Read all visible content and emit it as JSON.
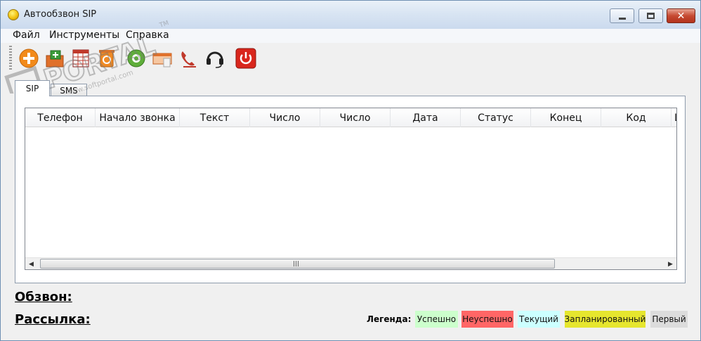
{
  "window": {
    "title": "Автообзвон SIP"
  },
  "menu": [
    "Файл",
    "Инструменты",
    "Справка"
  ],
  "toolbar": {
    "buttons": [
      {
        "name": "add-icon",
        "color": "#f28a1a"
      },
      {
        "name": "import-icon",
        "color": "#3b9b3b"
      },
      {
        "name": "table-icon",
        "color": "#c0392b"
      },
      {
        "name": "recycle-icon",
        "color": "#f08a24"
      },
      {
        "name": "settings-icon",
        "color": "#5fae3a"
      },
      {
        "name": "card-icon",
        "color": "#e0702a"
      },
      {
        "name": "phone-icon",
        "color": "#c0392b"
      },
      {
        "name": "headset-icon",
        "color": "#222222"
      },
      {
        "name": "power-icon",
        "color": "#d9261c"
      }
    ]
  },
  "tabs": [
    {
      "label": "SIP",
      "active": true
    },
    {
      "label": "SMS",
      "active": false
    }
  ],
  "grid": {
    "columns": [
      {
        "label": "Телефон"
      },
      {
        "label": "Начало звонка"
      },
      {
        "label": "Текст"
      },
      {
        "label": "Число"
      },
      {
        "label": "Число"
      },
      {
        "label": "Дата"
      },
      {
        "label": "Статус"
      },
      {
        "label": "Конец"
      },
      {
        "label": "Код"
      },
      {
        "label": "Ц"
      }
    ],
    "rows": [],
    "scroll_grip": "III"
  },
  "status": {
    "dial_label": "Обзвон:",
    "mailing_label": "Рассылка:"
  },
  "legend": {
    "title": "Легенда:",
    "items": [
      {
        "label": "Успешно",
        "color": "#ccffcc"
      },
      {
        "label": "Неуспешно",
        "color": "#ff6666"
      },
      {
        "label": "Текущий",
        "color": "#ccffff"
      },
      {
        "label": "Запланированный",
        "color": "#e6e62e"
      },
      {
        "label": "Первый",
        "color": "#dcdcdc"
      }
    ]
  },
  "watermark": {
    "text": "PORTAL",
    "url_text": "www.softportal.com",
    "mark": "TM"
  }
}
